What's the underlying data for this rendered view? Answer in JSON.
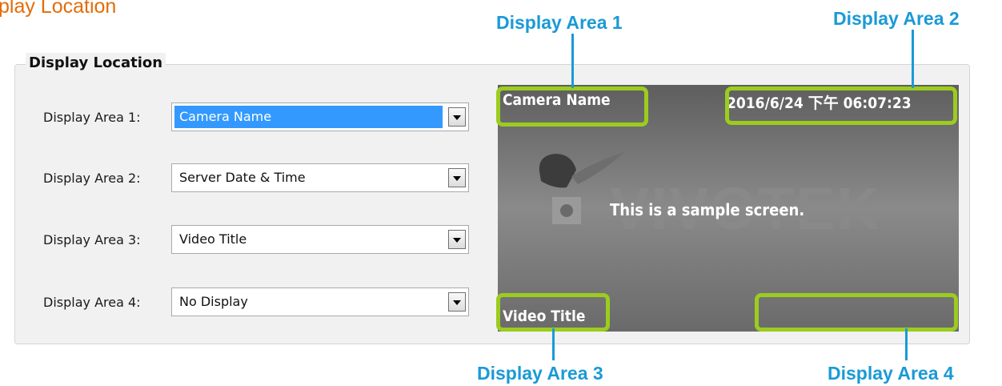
{
  "page_title": "play Location",
  "section": {
    "legend": "Display Location"
  },
  "rows": [
    {
      "label": "Display Area 1:",
      "value": "Camera Name"
    },
    {
      "label": "Display Area 2:",
      "value": "Server Date & Time"
    },
    {
      "label": "Display Area 3:",
      "value": "Video Title"
    },
    {
      "label": "Display Area 4:",
      "value": "No Display"
    }
  ],
  "preview": {
    "area1_text": "Camera Name",
    "area2_text": "2016/6/24 下午 06:07:23",
    "area3_text": "Video Title",
    "center_text": "This is a sample screen.",
    "watermark": "VIVOTEK"
  },
  "callouts": {
    "area1": "Display Area 1",
    "area2": "Display Area 2",
    "area3": "Display Area 3",
    "area4": "Display Area 4"
  },
  "colors": {
    "title": "#e36c0a",
    "callout": "#1a9ad6",
    "highlight": "#9ccc1e",
    "selection": "#3399ff"
  }
}
